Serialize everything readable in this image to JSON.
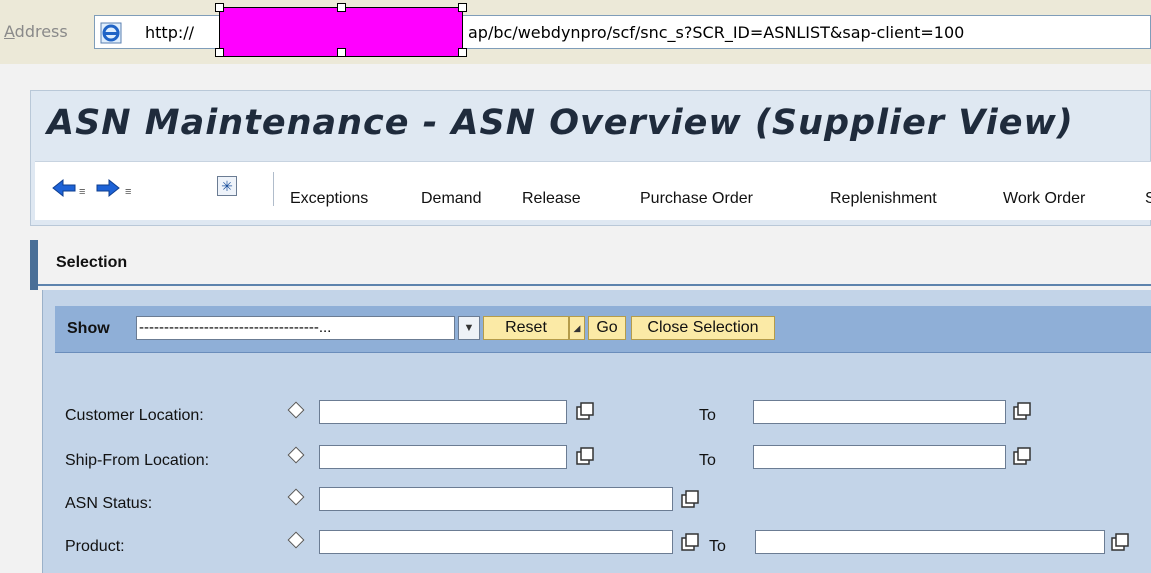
{
  "address_bar": {
    "label": "Address",
    "url_prefix": "http://",
    "url_suffix": "ap/bc/webdynpro/scf/snc_s?SCR_ID=ASNLIST&sap-client=100"
  },
  "page": {
    "title": "ASN Maintenance - ASN Overview (Supplier View)"
  },
  "toolbar": {
    "links": [
      "Exceptions",
      "Demand",
      "Release",
      "Purchase Order",
      "Replenishment",
      "Work Order",
      "S"
    ]
  },
  "selection": {
    "header": "Selection",
    "show_label": "Show",
    "show_value": "------------------------------------...",
    "reset_label": "Reset",
    "go_label": "Go",
    "close_label": "Close Selection"
  },
  "form": {
    "to_label": "To",
    "fields": [
      {
        "label": "Customer Location:",
        "value": "",
        "to_value": ""
      },
      {
        "label": "Ship-From Location:",
        "value": "",
        "to_value": ""
      },
      {
        "label": "ASN Status:",
        "value": ""
      },
      {
        "label": "Product:",
        "value": "",
        "to_value": ""
      }
    ]
  },
  "colors": {
    "mask": "#ff00ff",
    "selection_bg": "#c3d4e8",
    "show_bar": "#8fafd7",
    "button_yellow": "#fbeaa6",
    "title": "#1f2b3c"
  },
  "icons": {
    "browser": "ie-page-icon",
    "back": "back-arrow-icon",
    "forward": "forward-arrow-icon",
    "personalize": "star-icon",
    "value_help": "value-help-icon"
  }
}
